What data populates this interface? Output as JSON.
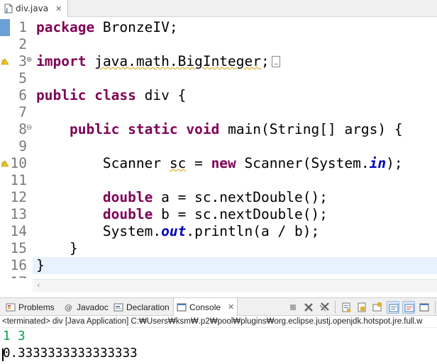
{
  "editor_tab": {
    "title": "div.java",
    "close_glyph": "✕"
  },
  "code_lines": [
    {
      "no": "1",
      "segments": [
        {
          "t": "package",
          "c": "kw"
        },
        {
          "t": " BronzeIV;"
        }
      ]
    },
    {
      "no": "2",
      "segments": []
    },
    {
      "no": "3",
      "segments": [
        {
          "t": "import",
          "c": "kw"
        },
        {
          "t": " "
        },
        {
          "t": "java.math.BigInteger",
          "c": "warn-ul"
        },
        {
          "t": ";"
        },
        {
          "box": true
        }
      ],
      "marker": "warning",
      "fold": "⊕"
    },
    {
      "no": "5",
      "segments": []
    },
    {
      "no": "6",
      "segments": [
        {
          "t": "public",
          "c": "kw"
        },
        {
          "t": " "
        },
        {
          "t": "class",
          "c": "kw"
        },
        {
          "t": " div {"
        }
      ]
    },
    {
      "no": "7",
      "segments": []
    },
    {
      "no": "8",
      "segments": [
        {
          "t": "    "
        },
        {
          "t": "public",
          "c": "kw"
        },
        {
          "t": " "
        },
        {
          "t": "static",
          "c": "kw"
        },
        {
          "t": " "
        },
        {
          "t": "void",
          "c": "kw"
        },
        {
          "t": " main(String[] args) {"
        }
      ],
      "fold": "⊖"
    },
    {
      "no": "9",
      "segments": []
    },
    {
      "no": "10",
      "segments": [
        {
          "t": "        Scanner "
        },
        {
          "t": "sc",
          "c": "warn-ul"
        },
        {
          "t": " = "
        },
        {
          "t": "new",
          "c": "kw"
        },
        {
          "t": " Scanner(System."
        },
        {
          "t": "in",
          "c": "field"
        },
        {
          "t": ");"
        }
      ],
      "marker": "warning"
    },
    {
      "no": "11",
      "segments": []
    },
    {
      "no": "12",
      "segments": [
        {
          "t": "        "
        },
        {
          "t": "double",
          "c": "kw"
        },
        {
          "t": " a = sc.nextDouble();"
        }
      ]
    },
    {
      "no": "13",
      "segments": [
        {
          "t": "        "
        },
        {
          "t": "double",
          "c": "kw"
        },
        {
          "t": " b = sc.nextDouble();"
        }
      ]
    },
    {
      "no": "14",
      "segments": [
        {
          "t": "        System."
        },
        {
          "t": "out",
          "c": "field"
        },
        {
          "t": ".println(a / b);"
        }
      ]
    },
    {
      "no": "15",
      "segments": [
        {
          "t": "    }"
        }
      ]
    },
    {
      "no": "16",
      "segments": [
        {
          "t": "}"
        }
      ],
      "current": true
    },
    {
      "no": "17",
      "segments": []
    }
  ],
  "panel_tabs": [
    {
      "label": "Problems",
      "icon": "problems-icon"
    },
    {
      "label": "Javadoc",
      "icon": "at-icon"
    },
    {
      "label": "Declaration",
      "icon": "declaration-icon"
    },
    {
      "label": "Console",
      "icon": "console-icon",
      "active": true
    }
  ],
  "console_tab_close": "✕",
  "toolbar_icons": [
    "terminate-icon",
    "remove-launch-icon",
    "remove-all-terminated-icon",
    "scroll-lock-icon",
    "word-wrap-icon",
    "pin-console-icon",
    "show-on-output-icon",
    "show-on-error-icon",
    "display-selected-console-icon",
    "open-console-icon"
  ],
  "console": {
    "header": "<terminated> div [Java Application] C:₩Users₩ksm₩.p2₩pool₩plugins₩org.eclipse.justj.openjdk.hotspot.jre.full.w",
    "input_line": "1 3",
    "output_line": "0.3333333333333333"
  },
  "colors": {
    "keyword": "#7f0055",
    "field": "#0000c0",
    "console_input": "#0a9e4a",
    "current_line": "#e8f2fe",
    "marker_blue": "#6b9fd6"
  }
}
